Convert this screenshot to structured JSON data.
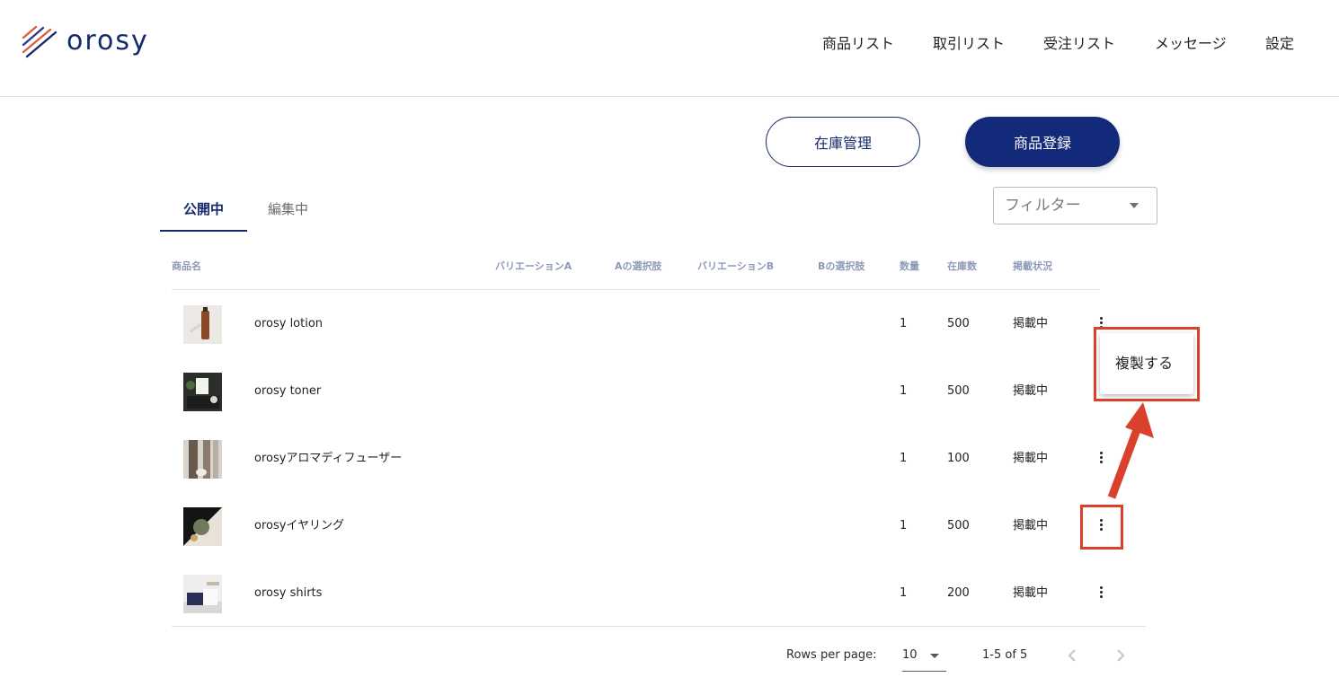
{
  "brand": {
    "name": "orosy",
    "accent": "#152a6b",
    "primary_button": "#132a7a",
    "highlight": "#d9412c"
  },
  "nav": {
    "items": [
      "商品リスト",
      "取引リスト",
      "受注リスト",
      "メッセージ",
      "設定"
    ]
  },
  "actions": {
    "inventory_label": "在庫管理",
    "register_label": "商品登録"
  },
  "tabs": {
    "items": [
      {
        "label": "公開中",
        "active": true
      },
      {
        "label": "編集中",
        "active": false
      }
    ]
  },
  "filter": {
    "label": "フィルター"
  },
  "table": {
    "columns": [
      "商品名",
      "バリエーションA",
      "Aの選択肢",
      "バリエーションB",
      "Bの選択肢",
      "数量",
      "在庫数",
      "掲載状況"
    ],
    "rows": [
      {
        "name": "orosy lotion",
        "quantity": "1",
        "stock": "500",
        "status": "掲載中",
        "thumb_icon": "lotion-bottle-photo"
      },
      {
        "name": "orosy toner",
        "quantity": "1",
        "stock": "500",
        "status": "掲載中",
        "thumb_icon": "toner-photo"
      },
      {
        "name": "orosyアロマディフューザー",
        "quantity": "1",
        "stock": "100",
        "status": "掲載中",
        "thumb_icon": "diffuser-photo"
      },
      {
        "name": "orosyイヤリング",
        "quantity": "1",
        "stock": "500",
        "status": "掲載中",
        "thumb_icon": "earring-photo"
      },
      {
        "name": "orosy shirts",
        "quantity": "1",
        "stock": "200",
        "status": "掲載中",
        "thumb_icon": "shirt-photo"
      }
    ]
  },
  "context_menu": {
    "duplicate_label": "複製する"
  },
  "pagination": {
    "rows_per_page_label": "Rows per page:",
    "rows_per_page_value": "10",
    "range": "1-5 of 5"
  }
}
